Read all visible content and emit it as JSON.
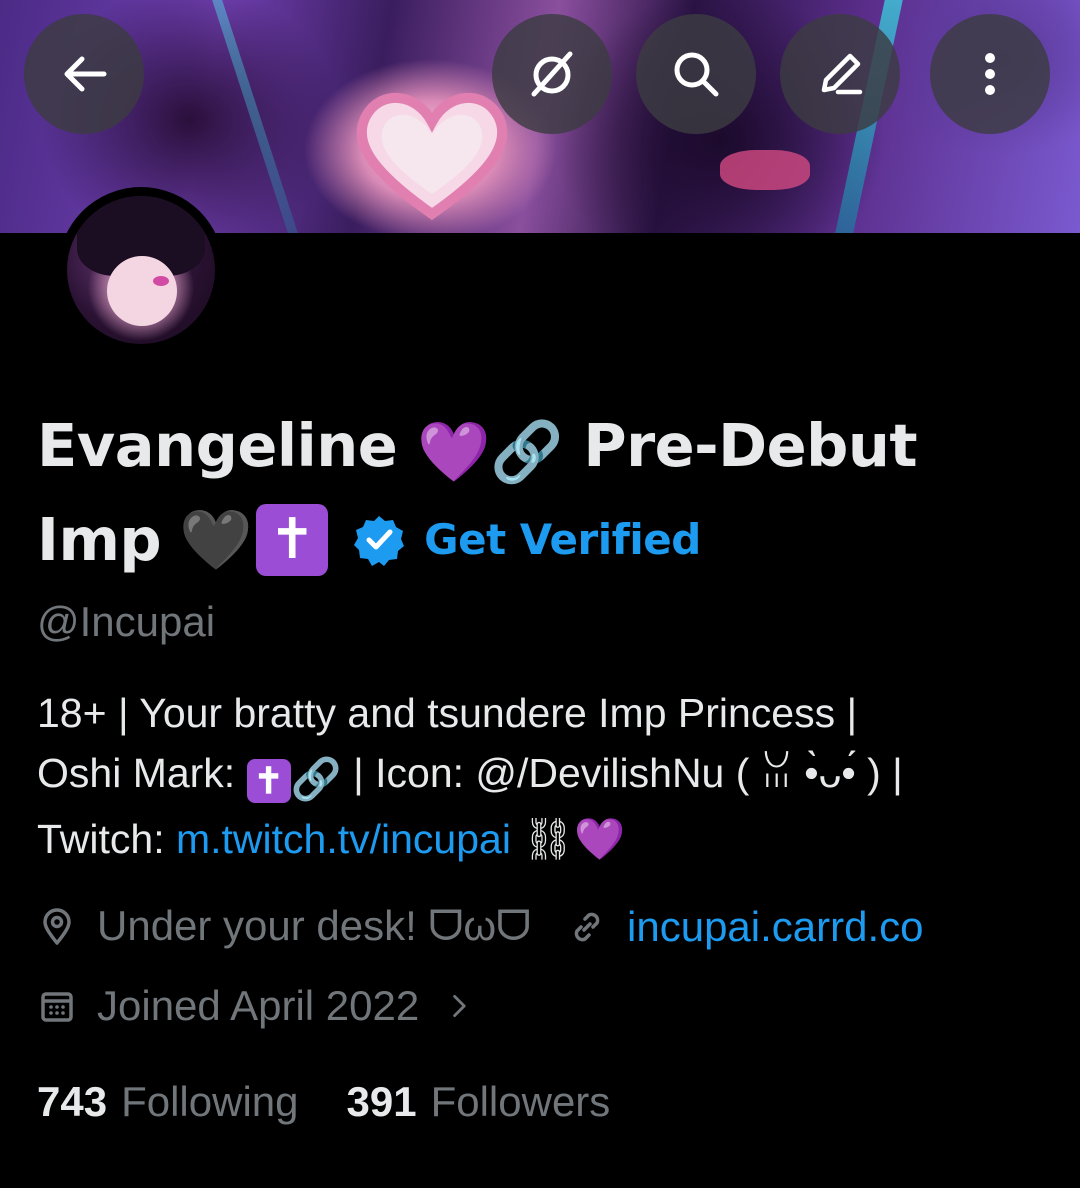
{
  "profile": {
    "display_name_part1": "Evangeline",
    "display_name_part2": "Pre-Debut",
    "display_name_part3": "Imp",
    "emoji_heart_purple": "💜",
    "emoji_link": "🔗",
    "emoji_heart_black": "🖤",
    "emoji_cross": "✝️",
    "get_verified_label": "Get Verified",
    "handle": "@Incupai",
    "bio_line1": "18+ |  Your bratty and tsundere Imp Princess |",
    "bio_line2_a": "Oshi Mark:",
    "bio_line2_b": "| Icon: @/DevilishNu ( ꈍ •̀ᴗ•́ ) |",
    "bio_line3_a": "Twitch:",
    "bio_link": "m.twitch.tv/incupai",
    "bio_line3_b": "⛓💜",
    "location": "Under your desk! ᗜωᗜ",
    "website": "incupai.carrd.co",
    "joined": "Joined April 2022",
    "following_count": "743",
    "following_label": "Following",
    "followers_count": "391",
    "followers_label": "Followers"
  },
  "colors": {
    "background": "#000000",
    "text_primary": "#e7e9ea",
    "text_secondary": "#71767b",
    "link": "#1d9bf0"
  },
  "icons": {
    "back": "back-arrow-icon",
    "grok": "grok-icon",
    "search": "search-icon",
    "edit": "edit-icon",
    "more": "more-vertical-icon",
    "verified": "verified-badge-icon",
    "location": "location-pin-icon",
    "website": "link-icon",
    "calendar": "calendar-icon",
    "chevron": "chevron-right-icon"
  }
}
